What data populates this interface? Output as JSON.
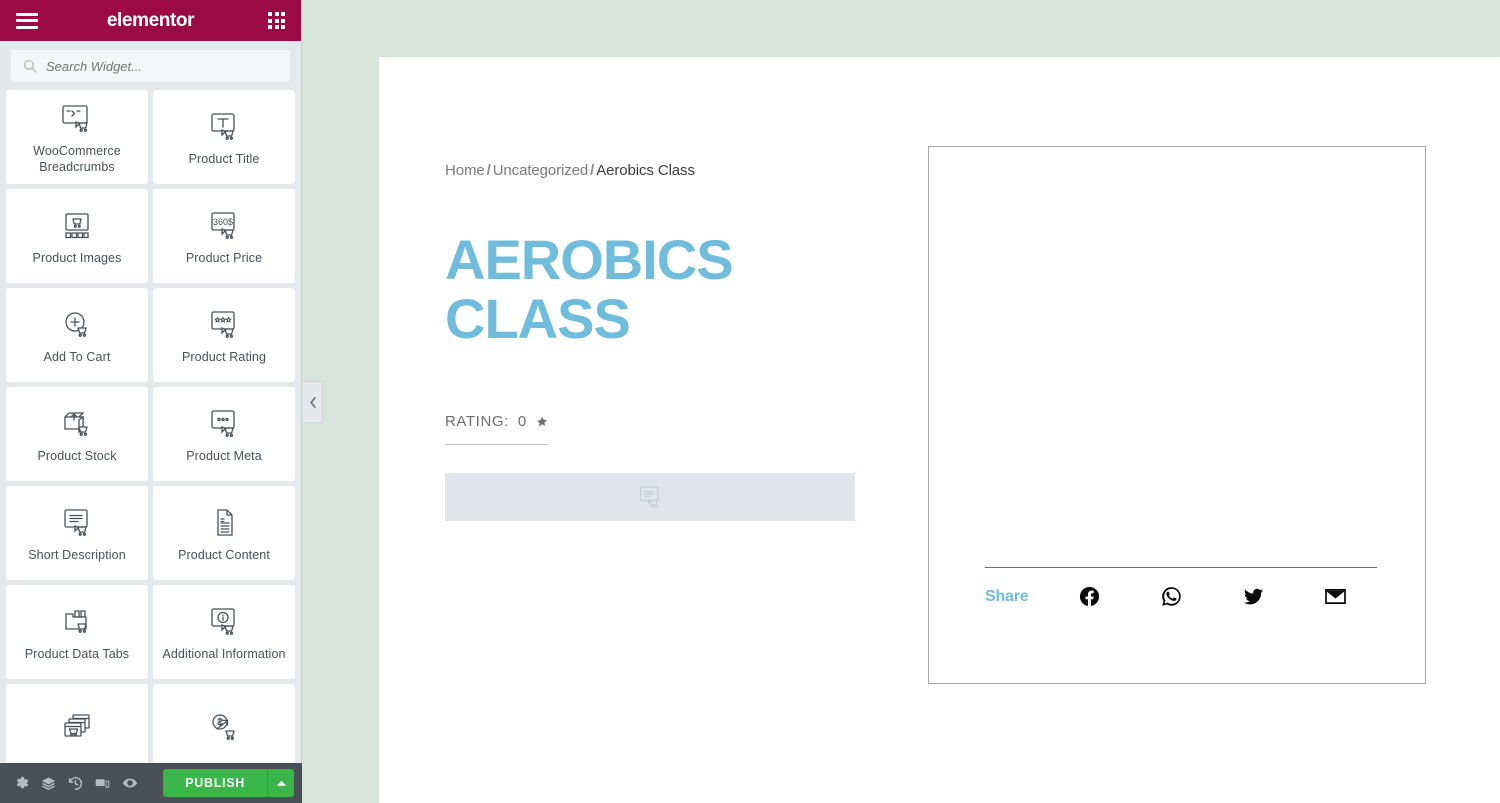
{
  "app": {
    "name": "elementor",
    "menu_icon": "hamburger-icon",
    "apps_icon": "grid-apps-icon"
  },
  "search": {
    "placeholder": "Search Widget...",
    "value": "",
    "icon": "search-icon"
  },
  "widgets": [
    {
      "label": "WooCommerce Breadcrumbs",
      "icon": "breadcrumbs-cart-icon"
    },
    {
      "label": "Product Title",
      "icon": "product-title-cart-icon"
    },
    {
      "label": "Product Images",
      "icon": "product-images-cart-icon"
    },
    {
      "label": "Product Price",
      "icon": "product-price-360-icon"
    },
    {
      "label": "Add To Cart",
      "icon": "add-to-cart-plus-icon"
    },
    {
      "label": "Product Rating",
      "icon": "product-rating-stars-icon"
    },
    {
      "label": "Product Stock",
      "icon": "product-stock-box-icon"
    },
    {
      "label": "Product Meta",
      "icon": "product-meta-dots-icon"
    },
    {
      "label": "Short Description",
      "icon": "short-description-lines-icon"
    },
    {
      "label": "Product Content",
      "icon": "product-content-document-icon"
    },
    {
      "label": "Product Data Tabs",
      "icon": "product-data-tabs-folder-icon"
    },
    {
      "label": "Additional Information",
      "icon": "additional-information-info-icon"
    },
    {
      "label": "",
      "icon": "product-related-stack-icon"
    },
    {
      "label": "",
      "icon": "upsells-price-arrow-icon"
    }
  ],
  "panel": {
    "collapse_icon": "chevron-left-icon"
  },
  "footer": {
    "buttons": [
      {
        "name": "settings",
        "icon": "gear-icon"
      },
      {
        "name": "navigator",
        "icon": "layers-icon"
      },
      {
        "name": "history",
        "icon": "history-clock-icon"
      },
      {
        "name": "responsive-mode",
        "icon": "responsive-devices-icon"
      },
      {
        "name": "preview",
        "icon": "eye-icon"
      }
    ],
    "publish_label": "PUBLISH",
    "publish_caret_icon": "chevron-up-icon",
    "publish_color": "#39b54a"
  },
  "canvas": {
    "background_color": "#d7e5dd",
    "breadcrumb": {
      "home": "Home",
      "category": "Uncategorized",
      "current": "Aerobics Class",
      "separator": "/"
    },
    "product_title": "AEROBICS CLASS",
    "title_color": "#6fbcdd",
    "rating": {
      "label": "RATING:",
      "value": "0",
      "star_icon": "star-icon"
    },
    "short_description_placeholder_icon": "short-description-lines-icon",
    "share": {
      "label": "Share",
      "label_color": "#6fbcdd",
      "networks": [
        {
          "name": "facebook",
          "icon": "facebook-icon"
        },
        {
          "name": "whatsapp",
          "icon": "whatsapp-icon"
        },
        {
          "name": "twitter",
          "icon": "twitter-icon"
        },
        {
          "name": "email",
          "icon": "email-icon"
        }
      ]
    }
  }
}
